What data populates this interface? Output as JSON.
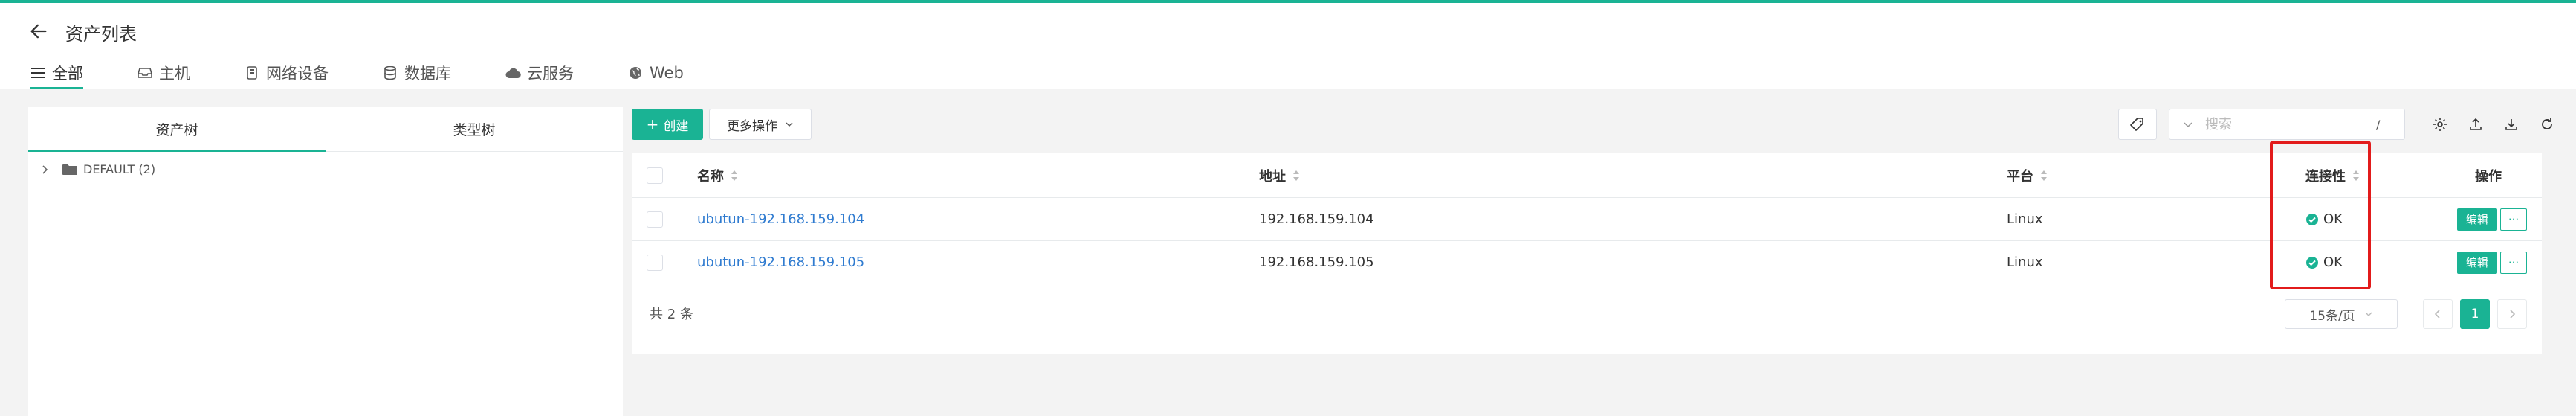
{
  "header": {
    "title": "资产列表",
    "tabs": [
      {
        "label": "全部",
        "icon": "list-icon"
      },
      {
        "label": "主机",
        "icon": "inbox-icon"
      },
      {
        "label": "网络设备",
        "icon": "server-icon"
      },
      {
        "label": "数据库",
        "icon": "database-icon"
      },
      {
        "label": "云服务",
        "icon": "cloud-icon"
      },
      {
        "label": "Web",
        "icon": "globe-icon"
      }
    ]
  },
  "left_panel": {
    "tabs": [
      {
        "label": "资产树"
      },
      {
        "label": "类型树"
      }
    ],
    "tree": [
      {
        "label": "DEFAULT (2)"
      }
    ]
  },
  "toolbar": {
    "create_label": "创建",
    "more_label": "更多操作",
    "search_placeholder": "搜索",
    "search_shortcut": "/"
  },
  "table": {
    "columns": {
      "name": "名称",
      "address": "地址",
      "platform": "平台",
      "connectivity": "连接性",
      "actions": "操作"
    },
    "rows": [
      {
        "name": "ubutun-192.168.159.104",
        "address": "192.168.159.104",
        "platform": "Linux",
        "connectivity": "OK",
        "edit": "编辑",
        "more": "···"
      },
      {
        "name": "ubutun-192.168.159.105",
        "address": "192.168.159.105",
        "platform": "Linux",
        "connectivity": "OK",
        "edit": "编辑",
        "more": "···"
      }
    ],
    "total": "共 2 条",
    "page_size": "15条/页",
    "current_page": "1"
  },
  "colors": {
    "accent": "#1ab394",
    "link": "#2f7bd0",
    "highlight": "#e21b1b"
  }
}
